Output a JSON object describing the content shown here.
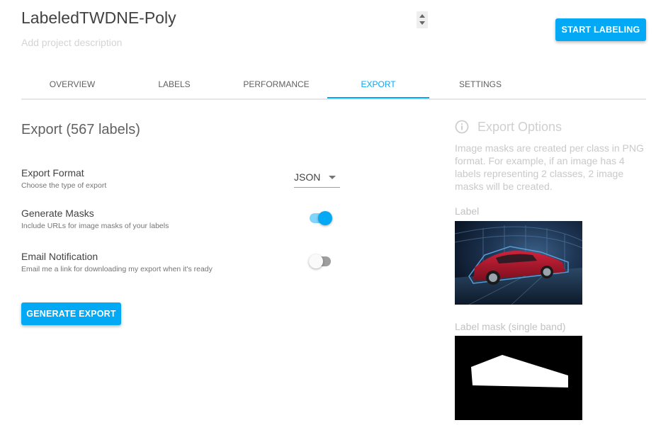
{
  "project": {
    "title": "LabeledTWDNE-Poly",
    "description_placeholder": "Add project description"
  },
  "header": {
    "start_label": "START LABELING"
  },
  "tabs": [
    {
      "label": "OVERVIEW",
      "active": false
    },
    {
      "label": "LABELS",
      "active": false
    },
    {
      "label": "PERFORMANCE",
      "active": false
    },
    {
      "label": "EXPORT",
      "active": true
    },
    {
      "label": "SETTINGS",
      "active": false
    }
  ],
  "export": {
    "heading": "Export (567 labels)",
    "format": {
      "title": "Export Format",
      "subtitle": "Choose the type of export",
      "value": "JSON"
    },
    "masks": {
      "title": "Generate Masks",
      "subtitle": "Include URLs for image masks of your labels",
      "enabled": true
    },
    "email": {
      "title": "Email Notification",
      "subtitle": "Email me a link for downloading my export when it's ready",
      "enabled": false
    },
    "generate_label": "GENERATE EXPORT"
  },
  "options": {
    "icon": "info-icon",
    "title": "Export Options",
    "description": "Image masks are created per class in PNG format. For example, if an image has 4 labels representing 2 classes, 2 image masks will be created.",
    "label_caption": "Label",
    "mask_caption": "Label mask (single band)"
  },
  "colors": {
    "accent": "#03a9f4",
    "toggle_track_on": "#81d4fa",
    "muted_text": "#c9c9c9"
  }
}
